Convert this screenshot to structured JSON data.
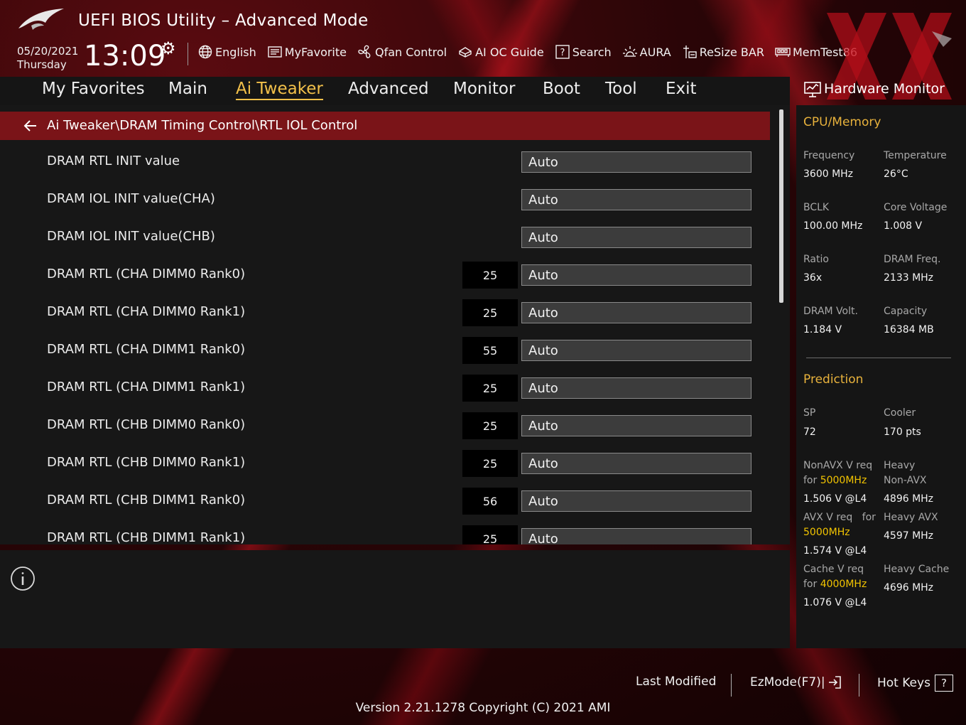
{
  "header": {
    "title": "UEFI BIOS Utility – Advanced Mode",
    "date": "05/20/2021",
    "weekday": "Thursday",
    "time": "13:09",
    "quickbar": [
      {
        "label": "English",
        "icon": "globe-icon"
      },
      {
        "label": "MyFavorite",
        "icon": "favorite-list-icon"
      },
      {
        "label": "Qfan Control",
        "icon": "fan-icon"
      },
      {
        "label": "AI OC Guide",
        "icon": "ai-oc-guide-icon"
      },
      {
        "label": "Search",
        "icon": "search-icon"
      },
      {
        "label": "AURA",
        "icon": "aura-light-icon"
      },
      {
        "label": "ReSize BAR",
        "icon": "resize-bar-icon"
      },
      {
        "label": "MemTest86",
        "icon": "memory-icon"
      }
    ]
  },
  "nav": {
    "tabs": [
      "My Favorites",
      "Main",
      "Ai Tweaker",
      "Advanced",
      "Monitor",
      "Boot",
      "Tool",
      "Exit"
    ],
    "active": "Ai Tweaker"
  },
  "main": {
    "breadcrumb": "Ai Tweaker\\DRAM Timing Control\\RTL IOL Control",
    "rows": [
      {
        "label": "DRAM RTL INIT value",
        "value": "",
        "setting": "Auto"
      },
      {
        "label": "DRAM IOL INIT value(CHA)",
        "value": "",
        "setting": "Auto"
      },
      {
        "label": "DRAM IOL INIT value(CHB)",
        "value": "",
        "setting": "Auto"
      },
      {
        "label": "DRAM RTL (CHA DIMM0 Rank0)",
        "value": "25",
        "setting": "Auto"
      },
      {
        "label": "DRAM RTL (CHA DIMM0 Rank1)",
        "value": "25",
        "setting": "Auto"
      },
      {
        "label": "DRAM RTL (CHA DIMM1 Rank0)",
        "value": "55",
        "setting": "Auto"
      },
      {
        "label": "DRAM RTL (CHA DIMM1 Rank1)",
        "value": "25",
        "setting": "Auto"
      },
      {
        "label": "DRAM RTL (CHB DIMM0 Rank0)",
        "value": "25",
        "setting": "Auto"
      },
      {
        "label": "DRAM RTL (CHB DIMM0 Rank1)",
        "value": "25",
        "setting": "Auto"
      },
      {
        "label": "DRAM RTL (CHB DIMM1 Rank0)",
        "value": "56",
        "setting": "Auto"
      },
      {
        "label": "DRAM RTL (CHB DIMM1 Rank1)",
        "value": "25",
        "setting": "Auto"
      }
    ]
  },
  "hwmon": {
    "title": "Hardware Monitor",
    "cpu_memory": {
      "heading": "CPU/Memory",
      "items": [
        {
          "label": "Frequency",
          "value": "3600 MHz"
        },
        {
          "label": "Temperature",
          "value": "26°C"
        },
        {
          "label": "BCLK",
          "value": "100.00 MHz"
        },
        {
          "label": "Core Voltage",
          "value": "1.008 V"
        },
        {
          "label": "Ratio",
          "value": "36x"
        },
        {
          "label": "DRAM Freq.",
          "value": "2133 MHz"
        },
        {
          "label": "DRAM Volt.",
          "value": "1.184 V"
        },
        {
          "label": "Capacity",
          "value": "16384 MB"
        }
      ]
    },
    "prediction": {
      "heading": "Prediction",
      "sp_label": "SP",
      "sp_value": "72",
      "cooler_label": "Cooler",
      "cooler_value": "170 pts",
      "nonavx_label_a": "NonAVX V req",
      "nonavx_label_b": "for",
      "nonavx_freq": "5000MHz",
      "nonavx_value": "1.506 V @L4",
      "heavy_nonavx_label_a": "Heavy",
      "heavy_nonavx_label_b": "Non-AVX",
      "heavy_nonavx_value": "4896 MHz",
      "avx_label_a": "AVX V req",
      "avx_label_b": "for",
      "avx_freq": "5000MHz",
      "avx_value": "1.574 V @L4",
      "heavy_avx_label": "Heavy AVX",
      "heavy_avx_value": "4597 MHz",
      "cache_label_a": "Cache V req",
      "cache_label_b": "for",
      "cache_freq": "4000MHz",
      "cache_value": "1.076 V @L4",
      "heavy_cache_label": "Heavy Cache",
      "heavy_cache_value": "4696 MHz"
    }
  },
  "footer": {
    "last_modified": "Last Modified",
    "ezmode": "EzMode(F7)|",
    "hotkeys": "Hot Keys",
    "hotkeys_key": "?",
    "version": "Version 2.21.1278 Copyright (C) 2021 AMI"
  },
  "colors": {
    "accent": "#f2c04a",
    "breadcrumb_bg": "#7a1418",
    "highlight": "#f2c400"
  }
}
